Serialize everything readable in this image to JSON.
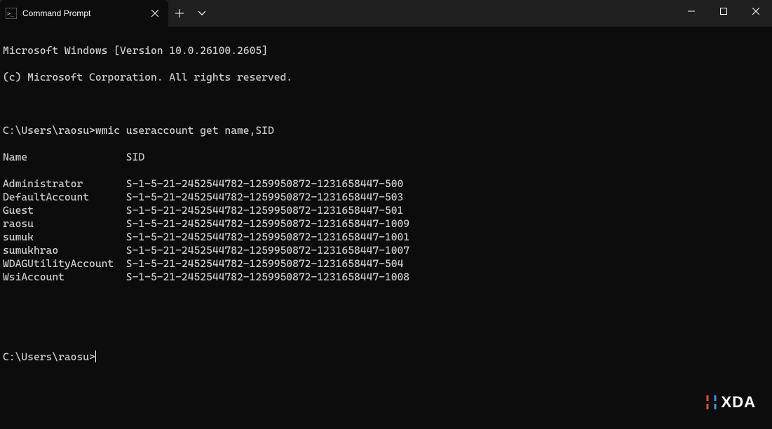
{
  "tab": {
    "title": "Command Prompt"
  },
  "banner": {
    "line1": "Microsoft Windows [Version 10.0.26100.2605]",
    "line2": "(c) Microsoft Corporation. All rights reserved."
  },
  "prompt1": "C:\\Users\\raosu>",
  "command1": "wmic useraccount get name,SID",
  "headers": {
    "name": "Name",
    "sid": "SID"
  },
  "accounts": [
    {
      "name": "Administrator",
      "sid": "S-1-5-21-2452544782-1259950872-1231658447-500"
    },
    {
      "name": "DefaultAccount",
      "sid": "S-1-5-21-2452544782-1259950872-1231658447-503"
    },
    {
      "name": "Guest",
      "sid": "S-1-5-21-2452544782-1259950872-1231658447-501"
    },
    {
      "name": "raosu",
      "sid": "S-1-5-21-2452544782-1259950872-1231658447-1009"
    },
    {
      "name": "sumuk",
      "sid": "S-1-5-21-2452544782-1259950872-1231658447-1001"
    },
    {
      "name": "sumukhrao",
      "sid": "S-1-5-21-2452544782-1259950872-1231658447-1007"
    },
    {
      "name": "WDAGUtilityAccount",
      "sid": "S-1-5-21-2452544782-1259950872-1231658447-504"
    },
    {
      "name": "WsiAccount",
      "sid": "S-1-5-21-2452544782-1259950872-1231658447-1008"
    }
  ],
  "prompt2": "C:\\Users\\raosu>",
  "watermark": "XDA"
}
